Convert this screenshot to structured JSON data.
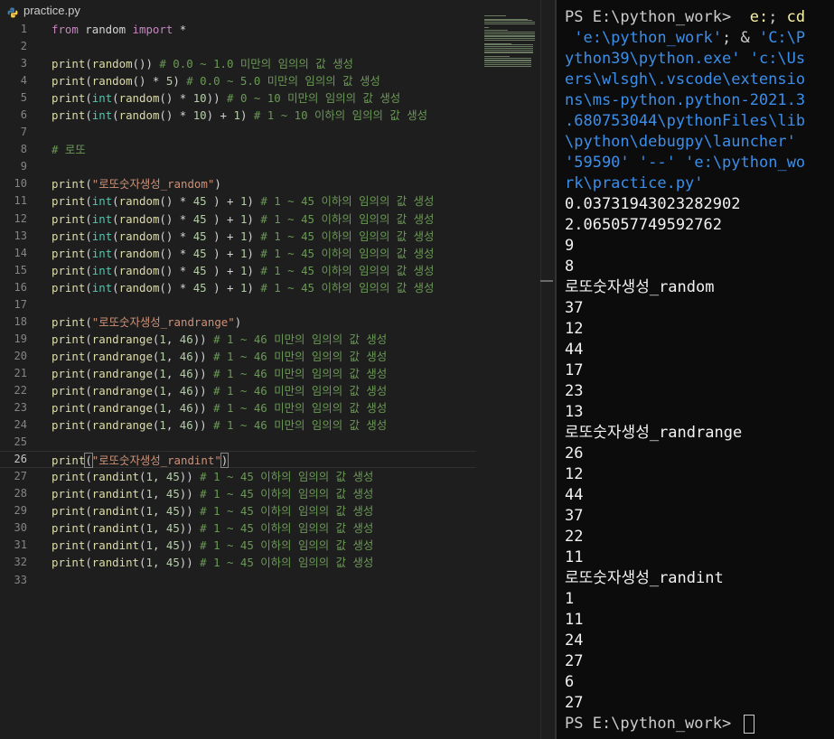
{
  "editor": {
    "tab_label": "practice.py",
    "tab_icon": "python-file-icon",
    "active_line": 26,
    "lines": [
      {
        "n": "1",
        "t": [
          [
            "kw",
            "from"
          ],
          [
            "p",
            " random "
          ],
          [
            "kw",
            "import"
          ],
          [
            "p",
            " *"
          ]
        ]
      },
      {
        "n": "2",
        "t": []
      },
      {
        "n": "3",
        "t": [
          [
            "fn",
            "print"
          ],
          [
            "p",
            "("
          ],
          [
            "fn",
            "random"
          ],
          [
            "p",
            "()) "
          ],
          [
            "cm",
            "# 0.0 ~ 1.0 미만의 임의의 값 생성"
          ]
        ]
      },
      {
        "n": "4",
        "t": [
          [
            "fn",
            "print"
          ],
          [
            "p",
            "("
          ],
          [
            "fn",
            "random"
          ],
          [
            "p",
            "() * "
          ],
          [
            "nm",
            "5"
          ],
          [
            "p",
            ") "
          ],
          [
            "cm",
            "# 0.0 ~ 5.0 미만의 임의의 값 생성"
          ]
        ]
      },
      {
        "n": "5",
        "t": [
          [
            "fn",
            "print"
          ],
          [
            "p",
            "("
          ],
          [
            "bi",
            "int"
          ],
          [
            "p",
            "("
          ],
          [
            "fn",
            "random"
          ],
          [
            "p",
            "() * "
          ],
          [
            "nm",
            "10"
          ],
          [
            "p",
            ")) "
          ],
          [
            "cm",
            "# 0 ~ 10 미만의 임의의 값 생성"
          ]
        ]
      },
      {
        "n": "6",
        "t": [
          [
            "fn",
            "print"
          ],
          [
            "p",
            "("
          ],
          [
            "bi",
            "int"
          ],
          [
            "p",
            "("
          ],
          [
            "fn",
            "random"
          ],
          [
            "p",
            "() * "
          ],
          [
            "nm",
            "10"
          ],
          [
            "p",
            ") + "
          ],
          [
            "nm",
            "1"
          ],
          [
            "p",
            ") "
          ],
          [
            "cm",
            "# 1 ~ 10 이하의 임의의 값 생성"
          ]
        ]
      },
      {
        "n": "7",
        "t": []
      },
      {
        "n": "8",
        "t": [
          [
            "cm",
            "# 로또"
          ]
        ]
      },
      {
        "n": "9",
        "t": []
      },
      {
        "n": "10",
        "t": [
          [
            "fn",
            "print"
          ],
          [
            "p",
            "("
          ],
          [
            "st",
            "\"로또숫자생성_random\""
          ],
          [
            "p",
            ")"
          ]
        ]
      },
      {
        "n": "11",
        "t": [
          [
            "fn",
            "print"
          ],
          [
            "p",
            "("
          ],
          [
            "bi",
            "int"
          ],
          [
            "p",
            "("
          ],
          [
            "fn",
            "random"
          ],
          [
            "p",
            "() * "
          ],
          [
            "nm",
            "45"
          ],
          [
            "p",
            " ) + "
          ],
          [
            "nm",
            "1"
          ],
          [
            "p",
            ") "
          ],
          [
            "cm",
            "# 1 ~ 45 이하의 임의의 값 생성"
          ]
        ]
      },
      {
        "n": "12",
        "t": [
          [
            "fn",
            "print"
          ],
          [
            "p",
            "("
          ],
          [
            "bi",
            "int"
          ],
          [
            "p",
            "("
          ],
          [
            "fn",
            "random"
          ],
          [
            "p",
            "() * "
          ],
          [
            "nm",
            "45"
          ],
          [
            "p",
            " ) + "
          ],
          [
            "nm",
            "1"
          ],
          [
            "p",
            ") "
          ],
          [
            "cm",
            "# 1 ~ 45 이하의 임의의 값 생성"
          ]
        ]
      },
      {
        "n": "13",
        "t": [
          [
            "fn",
            "print"
          ],
          [
            "p",
            "("
          ],
          [
            "bi",
            "int"
          ],
          [
            "p",
            "("
          ],
          [
            "fn",
            "random"
          ],
          [
            "p",
            "() * "
          ],
          [
            "nm",
            "45"
          ],
          [
            "p",
            " ) + "
          ],
          [
            "nm",
            "1"
          ],
          [
            "p",
            ") "
          ],
          [
            "cm",
            "# 1 ~ 45 이하의 임의의 값 생성"
          ]
        ]
      },
      {
        "n": "14",
        "t": [
          [
            "fn",
            "print"
          ],
          [
            "p",
            "("
          ],
          [
            "bi",
            "int"
          ],
          [
            "p",
            "("
          ],
          [
            "fn",
            "random"
          ],
          [
            "p",
            "() * "
          ],
          [
            "nm",
            "45"
          ],
          [
            "p",
            " ) + "
          ],
          [
            "nm",
            "1"
          ],
          [
            "p",
            ") "
          ],
          [
            "cm",
            "# 1 ~ 45 이하의 임의의 값 생성"
          ]
        ]
      },
      {
        "n": "15",
        "t": [
          [
            "fn",
            "print"
          ],
          [
            "p",
            "("
          ],
          [
            "bi",
            "int"
          ],
          [
            "p",
            "("
          ],
          [
            "fn",
            "random"
          ],
          [
            "p",
            "() * "
          ],
          [
            "nm",
            "45"
          ],
          [
            "p",
            " ) + "
          ],
          [
            "nm",
            "1"
          ],
          [
            "p",
            ") "
          ],
          [
            "cm",
            "# 1 ~ 45 이하의 임의의 값 생성"
          ]
        ]
      },
      {
        "n": "16",
        "t": [
          [
            "fn",
            "print"
          ],
          [
            "p",
            "("
          ],
          [
            "bi",
            "int"
          ],
          [
            "p",
            "("
          ],
          [
            "fn",
            "random"
          ],
          [
            "p",
            "() * "
          ],
          [
            "nm",
            "45"
          ],
          [
            "p",
            " ) + "
          ],
          [
            "nm",
            "1"
          ],
          [
            "p",
            ") "
          ],
          [
            "cm",
            "# 1 ~ 45 이하의 임의의 값 생성"
          ]
        ]
      },
      {
        "n": "17",
        "t": []
      },
      {
        "n": "18",
        "t": [
          [
            "fn",
            "print"
          ],
          [
            "p",
            "("
          ],
          [
            "st",
            "\"로또숫자생성_randrange\""
          ],
          [
            "p",
            ")"
          ]
        ]
      },
      {
        "n": "19",
        "t": [
          [
            "fn",
            "print"
          ],
          [
            "p",
            "("
          ],
          [
            "fn",
            "randrange"
          ],
          [
            "p",
            "("
          ],
          [
            "nm",
            "1"
          ],
          [
            "p",
            ", "
          ],
          [
            "nm",
            "46"
          ],
          [
            "p",
            ")) "
          ],
          [
            "cm",
            "# 1 ~ 46 미만의 임의의 값 생성"
          ]
        ]
      },
      {
        "n": "20",
        "t": [
          [
            "fn",
            "print"
          ],
          [
            "p",
            "("
          ],
          [
            "fn",
            "randrange"
          ],
          [
            "p",
            "("
          ],
          [
            "nm",
            "1"
          ],
          [
            "p",
            ", "
          ],
          [
            "nm",
            "46"
          ],
          [
            "p",
            ")) "
          ],
          [
            "cm",
            "# 1 ~ 46 미만의 임의의 값 생성"
          ]
        ]
      },
      {
        "n": "21",
        "t": [
          [
            "fn",
            "print"
          ],
          [
            "p",
            "("
          ],
          [
            "fn",
            "randrange"
          ],
          [
            "p",
            "("
          ],
          [
            "nm",
            "1"
          ],
          [
            "p",
            ", "
          ],
          [
            "nm",
            "46"
          ],
          [
            "p",
            ")) "
          ],
          [
            "cm",
            "# 1 ~ 46 미만의 임의의 값 생성"
          ]
        ]
      },
      {
        "n": "22",
        "t": [
          [
            "fn",
            "print"
          ],
          [
            "p",
            "("
          ],
          [
            "fn",
            "randrange"
          ],
          [
            "p",
            "("
          ],
          [
            "nm",
            "1"
          ],
          [
            "p",
            ", "
          ],
          [
            "nm",
            "46"
          ],
          [
            "p",
            ")) "
          ],
          [
            "cm",
            "# 1 ~ 46 미만의 임의의 값 생성"
          ]
        ]
      },
      {
        "n": "23",
        "t": [
          [
            "fn",
            "print"
          ],
          [
            "p",
            "("
          ],
          [
            "fn",
            "randrange"
          ],
          [
            "p",
            "("
          ],
          [
            "nm",
            "1"
          ],
          [
            "p",
            ", "
          ],
          [
            "nm",
            "46"
          ],
          [
            "p",
            ")) "
          ],
          [
            "cm",
            "# 1 ~ 46 미만의 임의의 값 생성"
          ]
        ]
      },
      {
        "n": "24",
        "t": [
          [
            "fn",
            "print"
          ],
          [
            "p",
            "("
          ],
          [
            "fn",
            "randrange"
          ],
          [
            "p",
            "("
          ],
          [
            "nm",
            "1"
          ],
          [
            "p",
            ", "
          ],
          [
            "nm",
            "46"
          ],
          [
            "p",
            ")) "
          ],
          [
            "cm",
            "# 1 ~ 46 미만의 임의의 값 생성"
          ]
        ]
      },
      {
        "n": "25",
        "t": []
      },
      {
        "n": "26",
        "t": [
          [
            "fn",
            "print"
          ],
          [
            "br",
            "("
          ],
          [
            "st",
            "\"로또숫자생성_randint\""
          ],
          [
            "br",
            ")"
          ]
        ]
      },
      {
        "n": "27",
        "t": [
          [
            "fn",
            "print"
          ],
          [
            "p",
            "("
          ],
          [
            "fn",
            "randint"
          ],
          [
            "p",
            "("
          ],
          [
            "nm",
            "1"
          ],
          [
            "p",
            ", "
          ],
          [
            "nm",
            "45"
          ],
          [
            "p",
            ")) "
          ],
          [
            "cm",
            "# 1 ~ 45 이하의 임의의 값 생성"
          ]
        ]
      },
      {
        "n": "28",
        "t": [
          [
            "fn",
            "print"
          ],
          [
            "p",
            "("
          ],
          [
            "fn",
            "randint"
          ],
          [
            "p",
            "("
          ],
          [
            "nm",
            "1"
          ],
          [
            "p",
            ", "
          ],
          [
            "nm",
            "45"
          ],
          [
            "p",
            ")) "
          ],
          [
            "cm",
            "# 1 ~ 45 이하의 임의의 값 생성"
          ]
        ]
      },
      {
        "n": "29",
        "t": [
          [
            "fn",
            "print"
          ],
          [
            "p",
            "("
          ],
          [
            "fn",
            "randint"
          ],
          [
            "p",
            "("
          ],
          [
            "nm",
            "1"
          ],
          [
            "p",
            ", "
          ],
          [
            "nm",
            "45"
          ],
          [
            "p",
            ")) "
          ],
          [
            "cm",
            "# 1 ~ 45 이하의 임의의 값 생성"
          ]
        ]
      },
      {
        "n": "30",
        "t": [
          [
            "fn",
            "print"
          ],
          [
            "p",
            "("
          ],
          [
            "fn",
            "randint"
          ],
          [
            "p",
            "("
          ],
          [
            "nm",
            "1"
          ],
          [
            "p",
            ", "
          ],
          [
            "nm",
            "45"
          ],
          [
            "p",
            ")) "
          ],
          [
            "cm",
            "# 1 ~ 45 이하의 임의의 값 생성"
          ]
        ]
      },
      {
        "n": "31",
        "t": [
          [
            "fn",
            "print"
          ],
          [
            "p",
            "("
          ],
          [
            "fn",
            "randint"
          ],
          [
            "p",
            "("
          ],
          [
            "nm",
            "1"
          ],
          [
            "p",
            ", "
          ],
          [
            "nm",
            "45"
          ],
          [
            "p",
            ")) "
          ],
          [
            "cm",
            "# 1 ~ 45 이하의 임의의 값 생성"
          ]
        ]
      },
      {
        "n": "32",
        "t": [
          [
            "fn",
            "print"
          ],
          [
            "p",
            "("
          ],
          [
            "fn",
            "randint"
          ],
          [
            "p",
            "("
          ],
          [
            "nm",
            "1"
          ],
          [
            "p",
            ", "
          ],
          [
            "nm",
            "45"
          ],
          [
            "p",
            ")) "
          ],
          [
            "cm",
            "# 1 ~ 45 이하의 임의의 값 생성"
          ]
        ]
      },
      {
        "n": "33",
        "t": []
      }
    ]
  },
  "terminal": {
    "command_prompt": "PS E:\\python_work> ",
    "command_lines": [
      [
        [
          "cmd-e",
          " e:"
        ],
        [
          "p",
          "; "
        ],
        [
          "cmd-e",
          "cd"
        ]
      ],
      [
        [
          "cmd-s",
          " 'e:\\python_work'"
        ],
        [
          "p",
          "; & "
        ],
        [
          "cmd-s",
          "'C:\\P"
        ]
      ],
      [
        [
          "cmd-s",
          "ython39\\python.exe'"
        ],
        [
          "p",
          " "
        ],
        [
          "cmd-s",
          "'c:\\Us"
        ]
      ],
      [
        [
          "cmd-s",
          "ers\\wlsgh\\.vscode\\extensio"
        ]
      ],
      [
        [
          "cmd-s",
          "ns\\ms-python.python-2021.3"
        ]
      ],
      [
        [
          "cmd-s",
          ".680753044\\pythonFiles\\lib"
        ]
      ],
      [
        [
          "cmd-s",
          "\\python\\debugpy\\launcher'"
        ]
      ],
      [
        [
          "cmd-s",
          "'59590'"
        ],
        [
          "p",
          " "
        ],
        [
          "cmd-s",
          "'--'"
        ],
        [
          "p",
          " "
        ],
        [
          "cmd-s",
          "'e:\\python_wo"
        ]
      ],
      [
        [
          "cmd-s",
          "rk\\practice.py'"
        ]
      ]
    ],
    "output": [
      "0.0373194302328290​2",
      "2.065057749592762",
      "9",
      "8",
      "로또숫자생성_random",
      "37",
      "12",
      "44",
      "17",
      "23",
      "13",
      "로또숫자생성_randrange",
      "26",
      "12",
      "44",
      "37",
      "22",
      "11",
      "로또숫자생성_randint",
      "1",
      "11",
      "24",
      "27",
      "6",
      "27"
    ],
    "final_prompt": "PS E:\\python_work> "
  }
}
